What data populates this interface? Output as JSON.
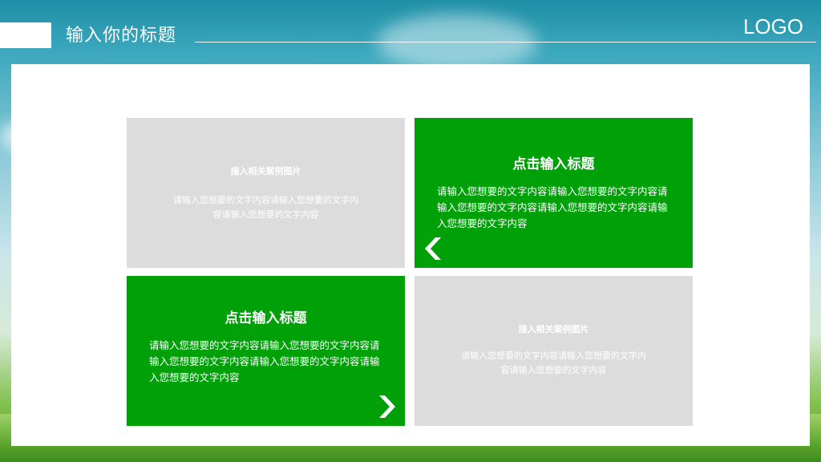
{
  "header": {
    "title": "输入你的标题",
    "logo": "LOGO"
  },
  "cards": {
    "top_left": {
      "image_label": "插入相关案例图片",
      "description": "请输入您想要的文字内容请输入您想要的文字内容请输入您想要的文字内容"
    },
    "top_right": {
      "title": "点击输入标题",
      "body": "请输入您想要的文字内容请输入您想要的文字内容请输入您想要的文字内容请输入您想要的文字内容请输入您想要的文字内容",
      "arrow_icon": "chevron-left-icon"
    },
    "bottom_left": {
      "title": "点击输入标题",
      "body": "请输入您想要的文字内容请输入您想要的文字内容请输入您想要的文字内容请输入您想要的文字内容请输入您想要的文字内容",
      "arrow_icon": "chevron-right-icon"
    },
    "bottom_right": {
      "image_label": "插入相关案例图片",
      "description": "请输入您想要的文字内容请输入您想要的文字内容请输入您想要的文字内容"
    }
  },
  "colors": {
    "accent_green": "#00a108",
    "placeholder_gray": "#dcdcdc",
    "panel_white": "#ffffff"
  }
}
